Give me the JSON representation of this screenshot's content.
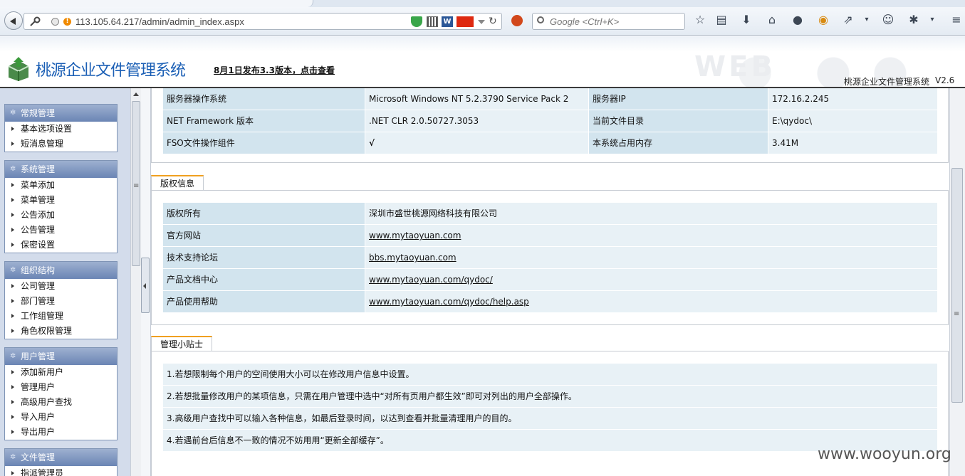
{
  "browser": {
    "url": "113.105.64.217/admin/admin_index.aspx",
    "search_placeholder": "Google <Ctrl+K>"
  },
  "header": {
    "title": "桃源企业文件管理系统",
    "release_link": "8月1日发布3.3版本，点击查看",
    "system_name": "桃源企业文件管理系统",
    "version": "V2.6",
    "decor_text": "WEB"
  },
  "sidebar": {
    "groups": [
      {
        "title": "常规管理",
        "items": [
          "基本选项设置",
          "短消息管理"
        ]
      },
      {
        "title": "系统管理",
        "items": [
          "菜单添加",
          "菜单管理",
          "公告添加",
          "公告管理",
          "保密设置"
        ]
      },
      {
        "title": "组织结构",
        "items": [
          "公司管理",
          "部门管理",
          "工作组管理",
          "角色权限管理"
        ]
      },
      {
        "title": "用户管理",
        "items": [
          "添加新用户",
          "管理用户",
          "高级用户查找",
          "导入用户",
          "导出用户"
        ]
      },
      {
        "title": "文件管理",
        "items": [
          "指派管理员"
        ]
      }
    ]
  },
  "server_info": {
    "rows": [
      {
        "label1": "服务器操作系统",
        "value1": "Microsoft Windows NT 5.2.3790 Service Pack 2",
        "label2": "服务器IP",
        "value2": "172.16.2.245"
      },
      {
        "label1": "NET Framework 版本",
        "value1": ".NET CLR 2.0.50727.3053",
        "label2": "当前文件目录",
        "value2": "E:\\qydoc\\"
      },
      {
        "label1": "FSO文件操作组件",
        "value1": "√",
        "label2": "本系统占用内存",
        "value2": "3.41M"
      }
    ]
  },
  "copyright": {
    "tab_label": "版权信息",
    "rows": [
      {
        "label": "版权所有",
        "value": "深圳市盛世桃源网络科技有限公司"
      },
      {
        "label": "官方网站",
        "value": "www.mytaoyuan.com"
      },
      {
        "label": "技术支持论坛",
        "value": "bbs.mytaoyuan.com"
      },
      {
        "label": "产品文档中心",
        "value": "www.mytaoyuan.com/qydoc/"
      },
      {
        "label": "产品使用帮助",
        "value": "www.mytaoyuan.com/qydoc/help.asp"
      }
    ]
  },
  "tips": {
    "tab_label": "管理小贴士",
    "items": [
      "1.若想限制每个用户的空间使用大小可以在修改用户信息中设置。",
      "2.若想批量修改用户的某项信息，只需在用户管理中选中“对所有页用户都生效”即可对列出的用户全部操作。",
      "3.高级用户查找中可以输入各种信息，如最后登录时间，以达到查看并批量清理用户的目的。",
      "4.若遇前台后信息不一致的情况不妨用用“更新全部缓存”。"
    ]
  },
  "watermark": "www.wooyun.org"
}
